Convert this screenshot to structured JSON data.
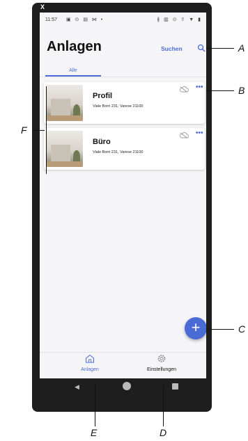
{
  "status_bar": {
    "time": "11:57",
    "left_icons": "▣ ⊙ ▤ ⋈ •",
    "right_icons": "∦ ▥ ⊙ ⇧ ▼ ▮"
  },
  "top_overlay_icon": "X",
  "header": {
    "title": "Anlagen",
    "search_label": "Suchen"
  },
  "tabs": [
    {
      "label": "Alle",
      "active": true
    }
  ],
  "cards": [
    {
      "name": "Profil",
      "address": "Viale Borri 231, Varese 21100"
    },
    {
      "name": "Büro",
      "address": "Viale Borri 231, Varese 21100"
    }
  ],
  "fab": {
    "label": "+"
  },
  "bottom_nav": [
    {
      "label": "Anlagen",
      "icon": "home-icon",
      "active": true
    },
    {
      "label": "Einstellungen",
      "icon": "gear-icon",
      "active": false
    }
  ],
  "callouts": {
    "A": "A",
    "B": "B",
    "C": "C",
    "D": "D",
    "E": "E",
    "F": "F"
  },
  "colors": {
    "accent": "#4a6bd6",
    "phone_frame": "#1e1e1e",
    "screen_bg": "#f5f5f7"
  }
}
